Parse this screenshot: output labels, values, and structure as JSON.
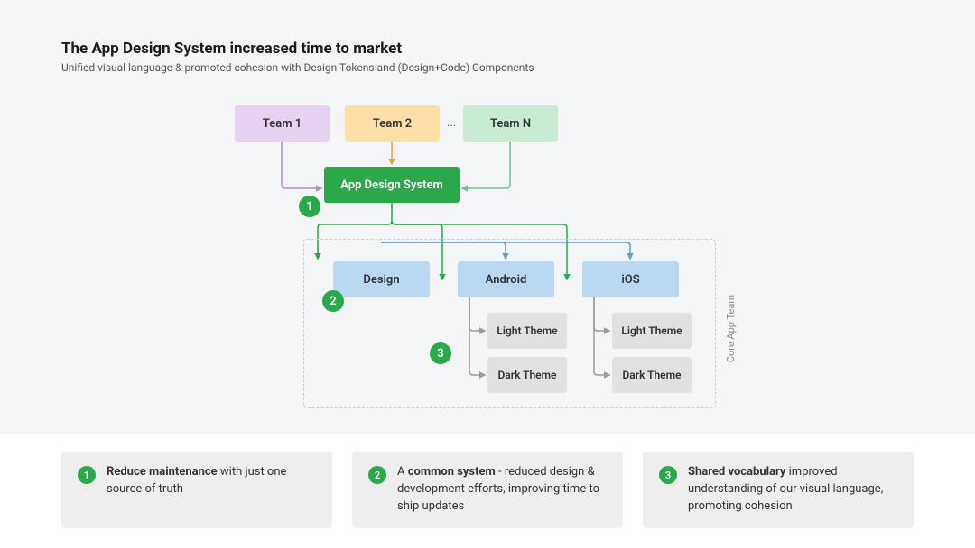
{
  "header": {
    "title": "The App Design System increased time to market",
    "subtitle": "Unified visual language & promoted cohesion with Design Tokens and (Design+Code) Components"
  },
  "diagram": {
    "teams": {
      "team1": "Team 1",
      "team2": "Team 2",
      "ellipsis": "...",
      "teamN": "Team N"
    },
    "app_design_system": "App Design System",
    "outputs": {
      "design": "Design",
      "android": "Android",
      "ios": "iOS"
    },
    "themes": {
      "light": "Light Theme",
      "dark": "Dark Theme"
    },
    "core_label": "Core App Team",
    "badges": {
      "b1": "1",
      "b2": "2",
      "b3": "3"
    }
  },
  "benefits": {
    "b1": {
      "num": "1",
      "bold": "Reduce maintenance",
      "rest": " with just one source of truth"
    },
    "b2": {
      "num": "2",
      "pre": "A ",
      "bold": "common system",
      "rest": " - reduced design & development efforts, improving time to ship updates"
    },
    "b3": {
      "num": "3",
      "bold": "Shared vocabulary",
      "rest": " improved understanding of our visual language, promoting cohesion"
    }
  }
}
